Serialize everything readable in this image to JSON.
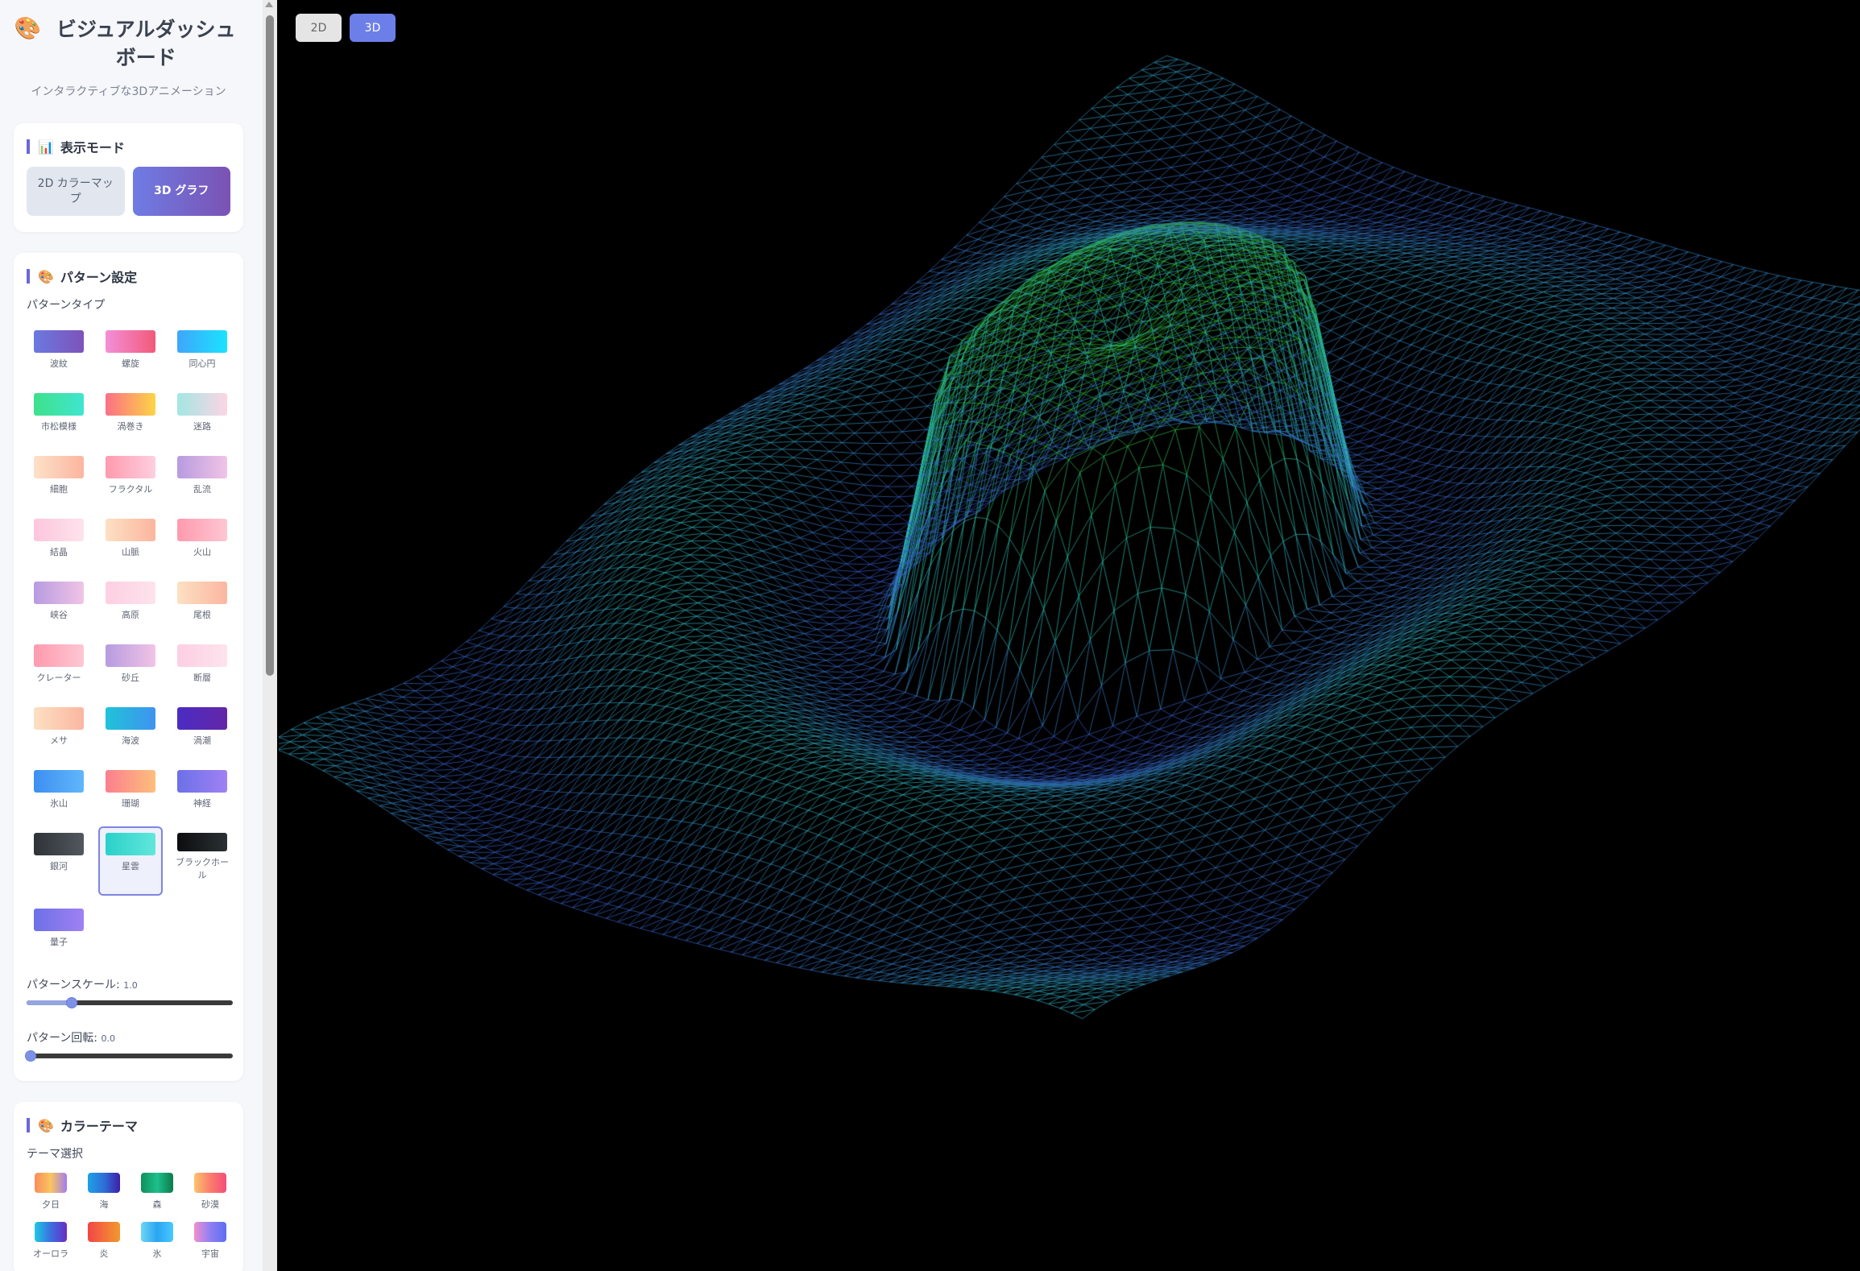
{
  "app": {
    "title_emoji": "🎨",
    "title": "ビジュアルダッシュボード",
    "subtitle": "インタラクティブな3Dアニメーション"
  },
  "display_mode": {
    "emoji": "📊",
    "title": "表示モード",
    "options": [
      {
        "label": "2D カラーマップ",
        "active": false
      },
      {
        "label": "3D グラフ",
        "active": true
      }
    ]
  },
  "pattern": {
    "emoji": "🎨",
    "title": "パターン設定",
    "type_label": "パターンタイプ",
    "items": [
      {
        "name": "波紋",
        "colors": [
          "#6a7ae0",
          "#7d52ba"
        ]
      },
      {
        "name": "螺旋",
        "colors": [
          "#f38fd8",
          "#f15a7a"
        ]
      },
      {
        "name": "同心円",
        "colors": [
          "#3fa6fb",
          "#19e3ff"
        ]
      },
      {
        "name": "市松模様",
        "colors": [
          "#3fe08a",
          "#3fe6d0"
        ]
      },
      {
        "name": "渦巻き",
        "colors": [
          "#fb6f86",
          "#fcd446"
        ]
      },
      {
        "name": "迷路",
        "colors": [
          "#a3e6e3",
          "#fcd5e4"
        ]
      },
      {
        "name": "細胞",
        "colors": [
          "#fde1c8",
          "#fcb59f"
        ]
      },
      {
        "name": "フラクタル",
        "colors": [
          "#ff9aae",
          "#fecfe0"
        ]
      },
      {
        "name": "乱流",
        "colors": [
          "#b79be0",
          "#f1c4e6"
        ]
      },
      {
        "name": "結晶",
        "colors": [
          "#fdc6dc",
          "#fde3ec"
        ]
      },
      {
        "name": "山脈",
        "colors": [
          "#fde0c3",
          "#fbb69f"
        ]
      },
      {
        "name": "火山",
        "colors": [
          "#ff9aae",
          "#fec7d3"
        ]
      },
      {
        "name": "峡谷",
        "colors": [
          "#b79be0",
          "#f1c4e6"
        ]
      },
      {
        "name": "高原",
        "colors": [
          "#fdcfe2",
          "#fde3ec"
        ]
      },
      {
        "name": "尾根",
        "colors": [
          "#fde0c3",
          "#fbb69f"
        ]
      },
      {
        "name": "クレーター",
        "colors": [
          "#ff9aae",
          "#fec7d3"
        ]
      },
      {
        "name": "砂丘",
        "colors": [
          "#b79be0",
          "#f1c4e6"
        ]
      },
      {
        "name": "断層",
        "colors": [
          "#fdcfe2",
          "#fde3ec"
        ]
      },
      {
        "name": "メサ",
        "colors": [
          "#fde0c3",
          "#fbb69f"
        ]
      },
      {
        "name": "海波",
        "colors": [
          "#1fc3d8",
          "#3f93f0"
        ]
      },
      {
        "name": "渦潮",
        "colors": [
          "#4a2cc2",
          "#6426a8"
        ]
      },
      {
        "name": "氷山",
        "colors": [
          "#3d8ff0",
          "#5fb7fb"
        ]
      },
      {
        "name": "珊瑚",
        "colors": [
          "#fb7e8e",
          "#fdbf7c"
        ]
      },
      {
        "name": "神経",
        "colors": [
          "#6c70e8",
          "#a081f3"
        ]
      },
      {
        "name": "銀河",
        "colors": [
          "#2f3338",
          "#52585e"
        ]
      },
      {
        "name": "星雲",
        "colors": [
          "#2ad1c9",
          "#62e6dc"
        ],
        "selected": true
      },
      {
        "name": "ブラックホール",
        "colors": [
          "#0c0d0e",
          "#2a3034"
        ]
      },
      {
        "name": "量子",
        "colors": [
          "#6c70e8",
          "#a081f3"
        ]
      }
    ],
    "scale_label": "パターンスケール:",
    "scale_value": "1.0",
    "scale_fraction": 0.2,
    "rotation_label": "パターン回転:",
    "rotation_value": "0.0",
    "rotation_fraction": 0.0
  },
  "color_theme": {
    "emoji": "🎨",
    "title": "カラーテーマ",
    "select_label": "テーマ選択",
    "items": [
      {
        "name": "夕日",
        "colors": [
          "#fb8c5c",
          "#f9c55f",
          "#a37cf0"
        ]
      },
      {
        "name": "海",
        "colors": [
          "#1ea0e6",
          "#2e6fd8",
          "#3d1fa8"
        ]
      },
      {
        "name": "森",
        "colors": [
          "#0f8f5c",
          "#1cc08c",
          "#0e7a4c"
        ]
      },
      {
        "name": "砂漠",
        "colors": [
          "#fbc36e",
          "#fb7c6c",
          "#f24e7a"
        ]
      },
      {
        "name": "オーロラ",
        "colors": [
          "#1fc8e3",
          "#3b6fe0",
          "#6a2cc4"
        ]
      },
      {
        "name": "炎",
        "colors": [
          "#f24545",
          "#f3703c",
          "#f09a2d"
        ]
      },
      {
        "name": "氷",
        "colors": [
          "#6dd6f3",
          "#2aa5f2",
          "#49c8ff"
        ]
      },
      {
        "name": "宇宙",
        "colors": [
          "#f28fd0",
          "#8f7ff2",
          "#5e6ef0"
        ]
      }
    ]
  },
  "view_toggle": [
    {
      "label": "2D",
      "active": false
    },
    {
      "label": "3D",
      "active": true
    }
  ],
  "scene": {
    "description_colors": {
      "low": "#3a3fd0",
      "mid": "#2ec4c0",
      "high": "#32c020"
    }
  }
}
